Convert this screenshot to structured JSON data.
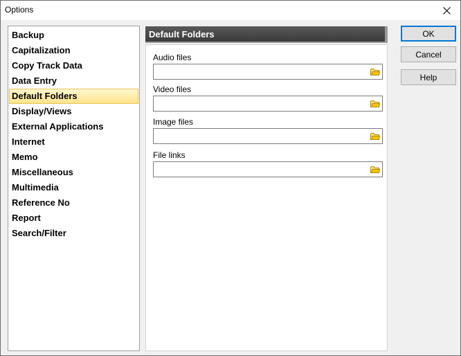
{
  "window": {
    "title": "Options"
  },
  "categories": [
    {
      "label": "Backup",
      "selected": false
    },
    {
      "label": "Capitalization",
      "selected": false
    },
    {
      "label": "Copy Track Data",
      "selected": false
    },
    {
      "label": "Data Entry",
      "selected": false
    },
    {
      "label": "Default Folders",
      "selected": true
    },
    {
      "label": "Display/Views",
      "selected": false
    },
    {
      "label": "External Applications",
      "selected": false
    },
    {
      "label": "Internet",
      "selected": false
    },
    {
      "label": "Memo",
      "selected": false
    },
    {
      "label": "Miscellaneous",
      "selected": false
    },
    {
      "label": "Multimedia",
      "selected": false
    },
    {
      "label": "Reference No",
      "selected": false
    },
    {
      "label": "Report",
      "selected": false
    },
    {
      "label": "Search/Filter",
      "selected": false
    }
  ],
  "panel": {
    "title": "Default Folders",
    "fields": [
      {
        "label": "Audio files",
        "value": "",
        "icon": "folder-icon"
      },
      {
        "label": "Video files",
        "value": "",
        "icon": "folder-icon"
      },
      {
        "label": "Image files",
        "value": "",
        "icon": "folder-icon"
      },
      {
        "label": "File links",
        "value": "",
        "icon": "folder-icon"
      }
    ]
  },
  "buttons": {
    "ok": "OK",
    "cancel": "Cancel",
    "help": "Help"
  },
  "colors": {
    "selection_top": "#fff6cf",
    "selection_bottom": "#ffe48c",
    "header_bg": "#4a4a4a",
    "default_button_border": "#0078d7",
    "folder_icon": "#f5c400"
  }
}
